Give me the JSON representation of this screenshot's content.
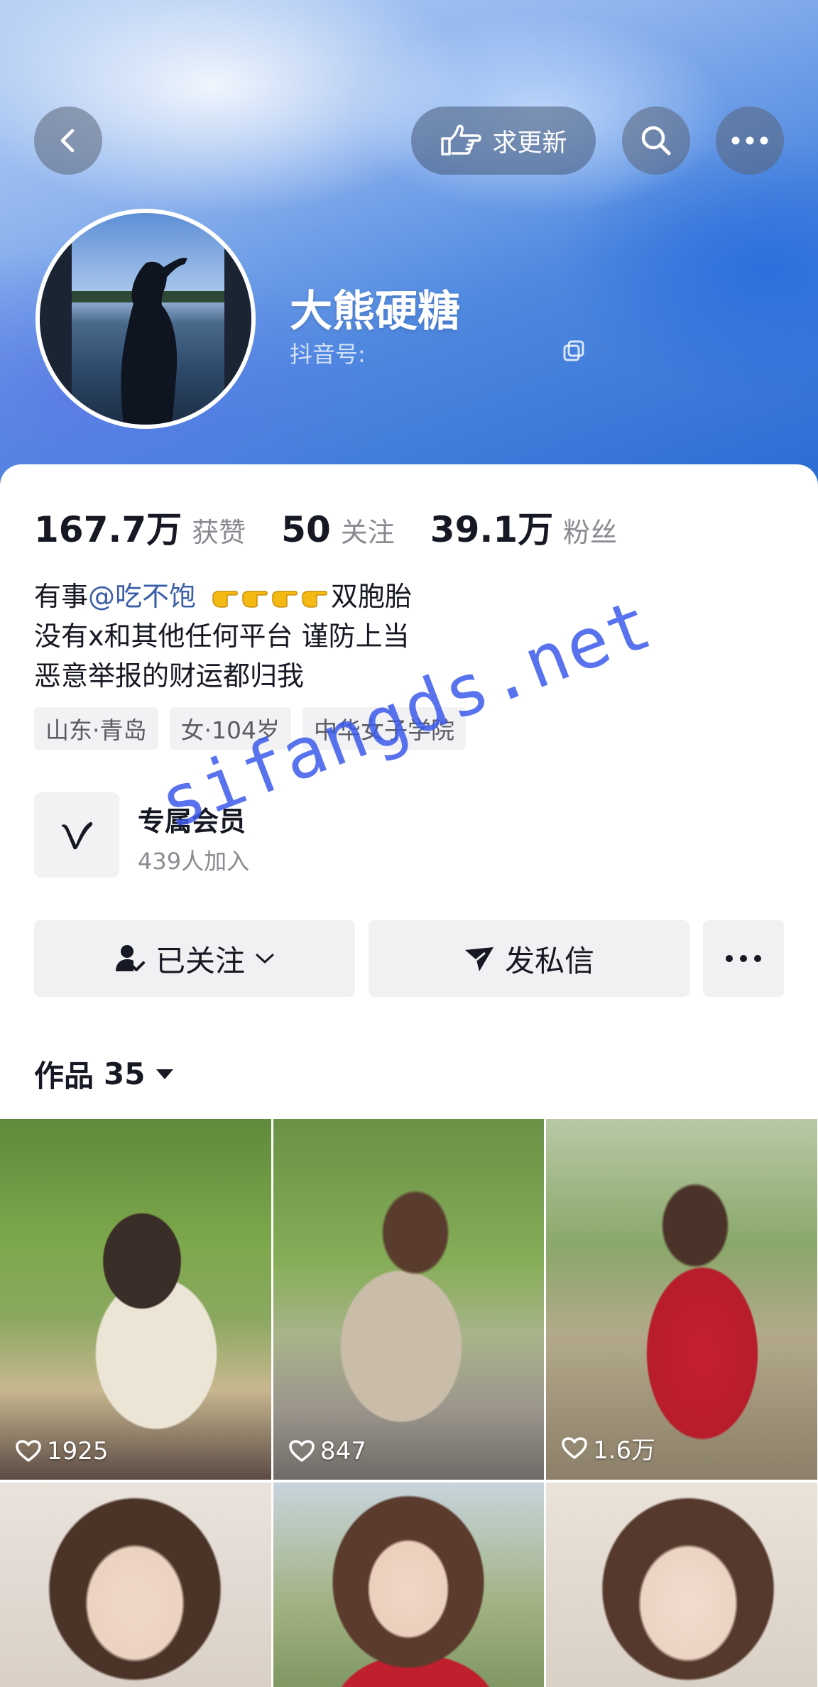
{
  "header": {
    "update_label": "求更新",
    "name": "大熊硬糖",
    "douyin_id_label": "抖音号:"
  },
  "stats": [
    {
      "value": "167.7万",
      "label": "获赞"
    },
    {
      "value": "50",
      "label": "关注"
    },
    {
      "value": "39.1万",
      "label": "粉丝"
    }
  ],
  "bio": {
    "line1_prefix": "有事",
    "mention": "@吃不饱",
    "line1_suffix": "双胞胎",
    "line2": "没有x和其他任何平台 谨防上当",
    "line3": "恶意举报的财运都归我"
  },
  "tags": [
    "山东·青岛",
    "女·104岁",
    "中华女子学院"
  ],
  "member": {
    "title": "专属会员",
    "subtitle": "439人加入"
  },
  "actions": {
    "follow_label": "已关注",
    "message_label": "发私信"
  },
  "works": {
    "label": "作品",
    "count": "35"
  },
  "grid": [
    {
      "likes": "1925"
    },
    {
      "likes": "847"
    },
    {
      "likes": "1.6万"
    },
    {
      "likes": ""
    },
    {
      "likes": ""
    },
    {
      "likes": ""
    }
  ],
  "watermark": "sifangds.net",
  "colors": {
    "mention": "#3a5fa8",
    "banner_blue": "#2a6bd3",
    "button_bg": "#f1f1f3",
    "watermark": "#3c5aeb"
  },
  "icons": [
    "back-icon",
    "point-hand-icon",
    "search-icon",
    "more-icon",
    "copy-icon",
    "member-v-icon",
    "person-check-icon",
    "chevron-down-icon",
    "send-icon",
    "triangle-down-icon",
    "heart-icon"
  ]
}
